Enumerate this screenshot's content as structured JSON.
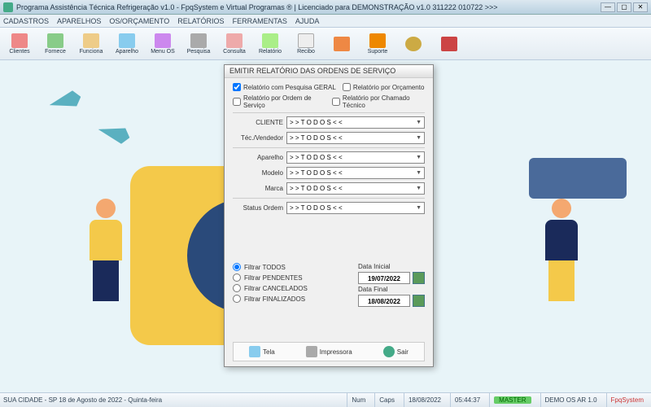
{
  "window": {
    "title": "Programa Assistência Técnica Refrigeração v1.0 - FpqSystem e Virtual Programas ® | Licenciado para  DEMONSTRAÇÃO v1.0 311222 010722 >>>"
  },
  "menu": [
    "CADASTROS",
    "APARELHOS",
    "OS/ORÇAMENTO",
    "RELATÓRIOS",
    "FERRAMENTAS",
    "AJUDA"
  ],
  "toolbar": [
    {
      "label": "Clientes",
      "color": "#e88"
    },
    {
      "label": "Fornece",
      "color": "#8c8"
    },
    {
      "label": "Funciona",
      "color": "#ec8"
    },
    {
      "label": "Aparelho",
      "color": "#8ce"
    },
    {
      "label": "Menu OS",
      "color": "#c8e"
    },
    {
      "label": "Pesquisa",
      "color": "#aaa"
    },
    {
      "label": "Consulta",
      "color": "#eaa"
    },
    {
      "label": "Relatório",
      "color": "#ae8"
    },
    {
      "label": "Recibo",
      "color": "#eee"
    },
    {
      "label": "",
      "color": "#e84"
    },
    {
      "label": "Suporte",
      "color": "#e80"
    },
    {
      "label": "",
      "color": "#ca4"
    },
    {
      "label": "",
      "color": "#c44"
    }
  ],
  "dialog": {
    "title": "EMITIR RELATÓRIO DAS ORDENS DE SERVIÇO",
    "checks": {
      "c1": "Relatório com Pesquisa GERAL",
      "c2": "Relatório por Orçamento",
      "c3": "Relatório por Ordem de Serviço",
      "c4": "Relatório por Chamado Técnico"
    },
    "fields": {
      "cliente": {
        "label": "CLIENTE",
        "value": "> >  T O D O S  < <"
      },
      "tecnico": {
        "label": "Téc./Vendedor",
        "value": "> >  T O D O S  < <"
      },
      "aparelho": {
        "label": "Aparelho",
        "value": "> >  T O D O S  < <"
      },
      "modelo": {
        "label": "Modelo",
        "value": "> >  T O D O S  < <"
      },
      "marca": {
        "label": "Marca",
        "value": "> >  T O D O S  < <"
      },
      "status": {
        "label": "Status Ordem",
        "value": "> >  T O D O S  < <"
      }
    },
    "radios": {
      "r1": "Filtrar TODOS",
      "r2": "Filtrar PENDENTES",
      "r3": "Filtrar CANCELADOS",
      "r4": "Filtrar FINALIZADOS"
    },
    "dates": {
      "ini_label": "Data Inicial",
      "ini_value": "19/07/2022",
      "fin_label": "Data Final",
      "fin_value": "18/08/2022"
    },
    "footer": {
      "tela": "Tela",
      "impressora": "Impressora",
      "sair": "Sair"
    }
  },
  "status": {
    "left": "SUA CIDADE - SP 18 de Agosto de 2022 - Quinta-feira",
    "num": "Num",
    "caps": "Caps",
    "date": "18/08/2022",
    "time": "05:44:37",
    "master": "MASTER",
    "demo": "DEMO OS AR 1.0",
    "brand": "FpqSystem"
  }
}
